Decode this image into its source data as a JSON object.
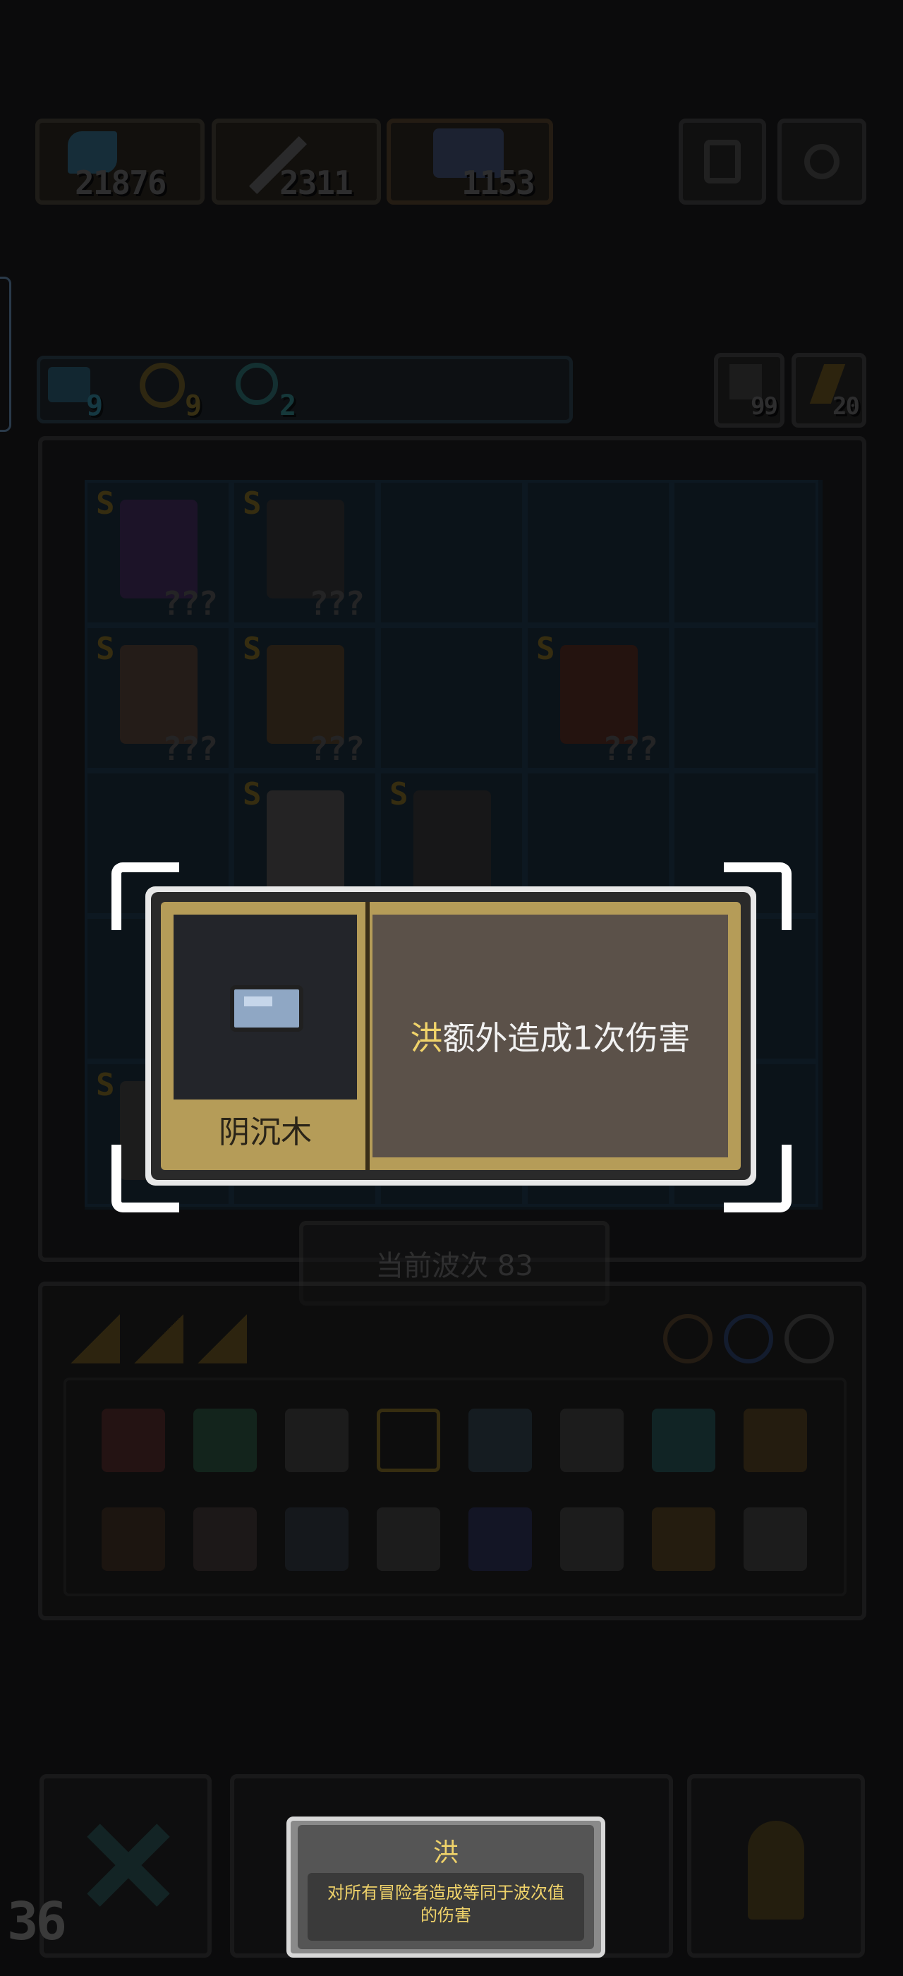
{
  "resources": {
    "gems": "21876",
    "sword": "2311",
    "hero": "1153"
  },
  "buffs": {
    "a": "9",
    "b": "9",
    "c": "2",
    "right_a": "99",
    "right_b": "20"
  },
  "board": {
    "unknown_mark": "???",
    "rank_letter": "S"
  },
  "wave": {
    "label": "当前波次 83"
  },
  "popup": {
    "item_name": "阴沉木",
    "desc_highlight": "洪",
    "desc_text": "额外造成1次伤害",
    "highlight_color": "#f0d36a"
  },
  "tooltip": {
    "title": "洪",
    "body": "对所有冒险者造成等同于波次值的伤害"
  },
  "corner_number": "36"
}
